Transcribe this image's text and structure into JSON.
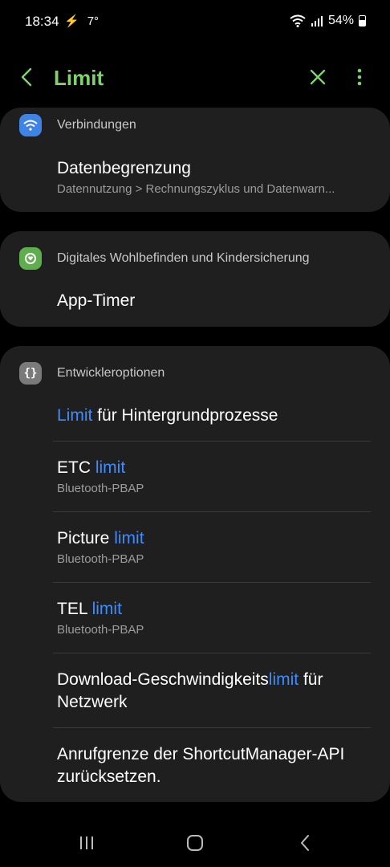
{
  "status": {
    "time": "18:34",
    "temperature": "7°",
    "battery": "54%"
  },
  "appbar": {
    "title": "Limit"
  },
  "sections": {
    "connections": {
      "label": "Verbindungen",
      "item_title": "Datenbegrenzung",
      "item_sub": "Datennutzung > Rechnungszyklus und Datenwarn..."
    },
    "wellbeing": {
      "label": "Digitales Wohlbefinden und Kindersicherung",
      "item_title": "App-Timer"
    },
    "developer": {
      "label": "Entwickleroptionen",
      "items": [
        {
          "hl": "Limit",
          "rest": " für Hintergrundprozesse"
        },
        {
          "pre": "ETC ",
          "hl": "limit",
          "sub": "Bluetooth-PBAP"
        },
        {
          "pre": "Picture ",
          "hl": "limit",
          "sub": "Bluetooth-PBAP"
        },
        {
          "pre": "TEL ",
          "hl": "limit",
          "sub": "Bluetooth-PBAP"
        },
        {
          "pre": "Download-Geschwindigkeits",
          "hl": "limit",
          "rest": " für Netzwerk"
        },
        {
          "title": "Anrufgrenze der ShortcutManager-API zurücksetzen."
        }
      ]
    }
  },
  "colors": {
    "accent": "#7ed36b",
    "highlight": "#3f8cff",
    "card": "#1f1f1f"
  }
}
